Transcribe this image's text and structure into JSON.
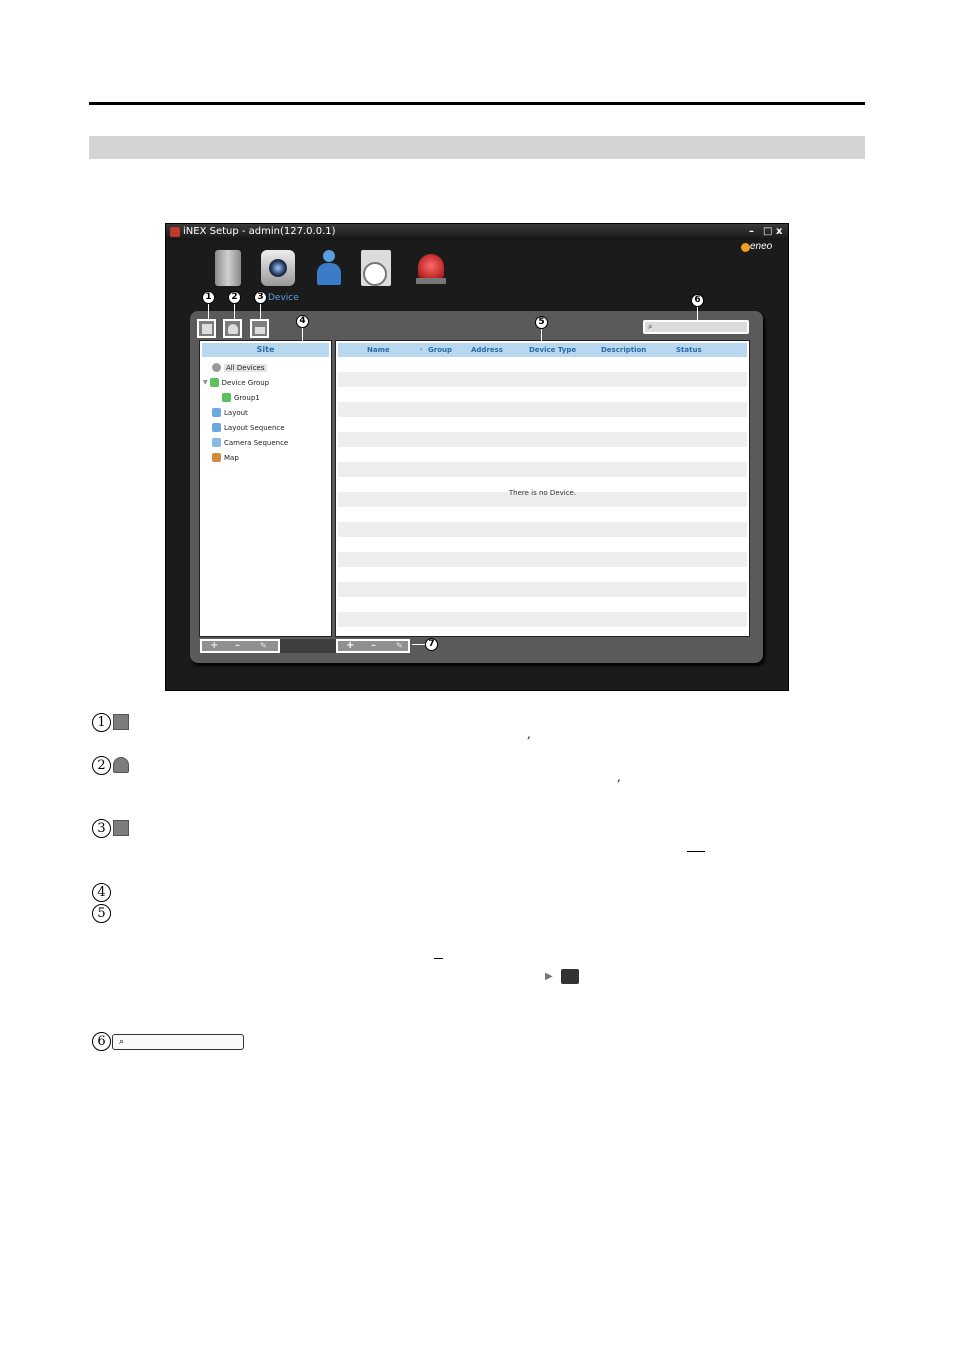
{
  "window": {
    "title": "iNEX Setup - admin(127.0.0.1)",
    "controls": {
      "minimize": "–",
      "maximize": "□",
      "close": "x"
    },
    "brand": "eneo"
  },
  "top_nav": {
    "device_label": "Device",
    "icons": [
      "server-icon",
      "device-camera-icon",
      "user-icon",
      "schedule-icon",
      "alarm-siren-icon"
    ]
  },
  "search": {
    "placeholder": ""
  },
  "tree": {
    "header": "Site",
    "items": [
      {
        "label": "All Devices",
        "icon": "all-devices-icon",
        "selected": true
      },
      {
        "label": "Device Group",
        "icon": "device-group-icon",
        "expanded": true
      },
      {
        "label": "Group1",
        "icon": "group-icon"
      },
      {
        "label": "Layout",
        "icon": "layout-icon"
      },
      {
        "label": "Layout Sequence",
        "icon": "layout-sequence-icon"
      },
      {
        "label": "Camera Sequence",
        "icon": "camera-sequence-icon"
      },
      {
        "label": "Map",
        "icon": "map-icon"
      }
    ]
  },
  "device_list": {
    "columns": [
      "Name",
      "Group",
      "Address",
      "Device Type",
      "Description",
      "Status"
    ],
    "empty_message": "There is no Device."
  },
  "callouts": [
    "1",
    "2",
    "3",
    "4",
    "5",
    "6",
    "7"
  ],
  "legend": {
    "numbers": [
      "1",
      "2",
      "3",
      "4",
      "5",
      "6"
    ],
    "marks": [
      ",",
      ","
    ]
  },
  "colors": {
    "header_blue": "#b8d8ef",
    "header_text": "#2a6aa8",
    "panel_gray": "#5a5a5a",
    "window_bg": "#1b1b1b",
    "section_bar": "#d4d4d4"
  }
}
